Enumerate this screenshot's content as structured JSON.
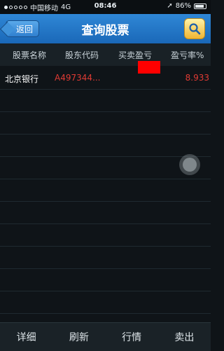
{
  "status_bar": {
    "carrier": "中国移动",
    "network": "4G",
    "time": "08:46",
    "battery": "86%",
    "battery_level": 0.86
  },
  "nav": {
    "back_label": "返回",
    "title": "查询股票",
    "search_icon": "search-icon"
  },
  "table": {
    "columns": [
      "股票名称",
      "股东代码",
      "买卖盈亏",
      "盈亏率%"
    ],
    "rows": [
      {
        "name": "北京银行",
        "code": "A497344...",
        "pnl": "",
        "ratio": "8.933"
      }
    ]
  },
  "toolbar": {
    "buttons": [
      "详细",
      "刷新",
      "行情",
      "卖出"
    ]
  },
  "colors": {
    "nav_blue": "#1a68b8",
    "loss_red": "#e03b34",
    "background": "#0f1418"
  }
}
